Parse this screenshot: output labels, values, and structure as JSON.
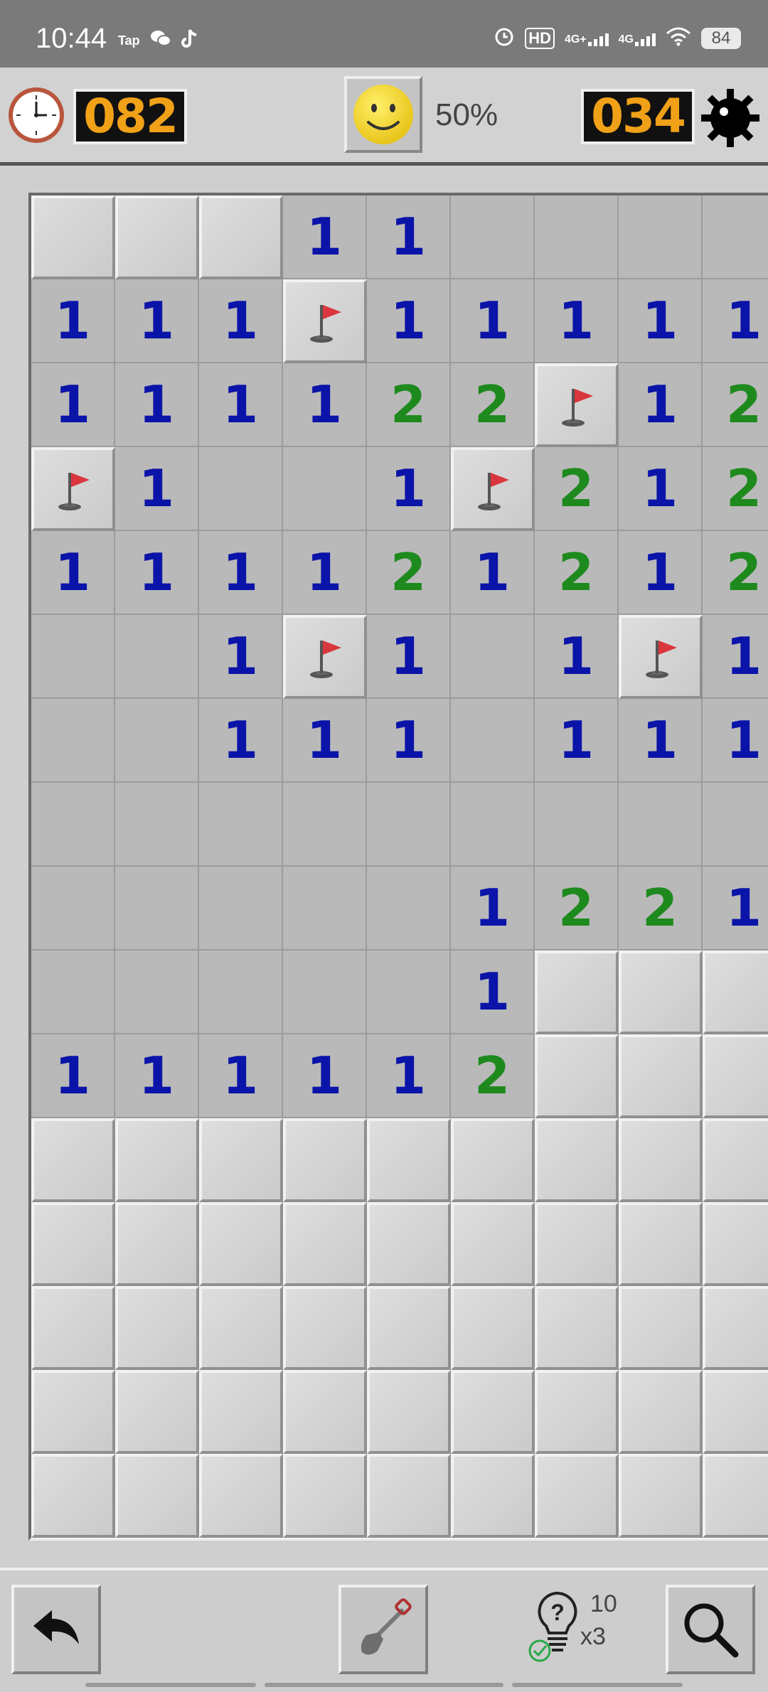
{
  "status_bar": {
    "time": "10:44",
    "apps": [
      "Tap",
      "wechat-icon",
      "tiktok-icon"
    ],
    "hd_label": "HD",
    "net1": "4G+",
    "net2": "4G",
    "battery": "84"
  },
  "header": {
    "timer": "082",
    "progress": "50%",
    "mines_left": "034"
  },
  "board": {
    "cols": 9,
    "rows": 16,
    "cells": [
      [
        "C",
        "C",
        "C",
        "1",
        "1",
        "0",
        "0",
        "0",
        "0"
      ],
      [
        "1",
        "1",
        "1",
        "F",
        "1",
        "1",
        "1",
        "1",
        "1"
      ],
      [
        "1",
        "1",
        "1",
        "1",
        "2",
        "2",
        "F",
        "1",
        "2"
      ],
      [
        "F",
        "1",
        "0",
        "0",
        "1",
        "F",
        "2",
        "1",
        "2"
      ],
      [
        "1",
        "1",
        "1",
        "1",
        "2",
        "1",
        "2",
        "1",
        "2"
      ],
      [
        "0",
        "0",
        "1",
        "F",
        "1",
        "0",
        "1",
        "F",
        "1"
      ],
      [
        "0",
        "0",
        "1",
        "1",
        "1",
        "0",
        "1",
        "1",
        "1"
      ],
      [
        "0",
        "0",
        "0",
        "0",
        "0",
        "0",
        "0",
        "0",
        "0"
      ],
      [
        "0",
        "0",
        "0",
        "0",
        "0",
        "1",
        "2",
        "2",
        "1"
      ],
      [
        "0",
        "0",
        "0",
        "0",
        "0",
        "1",
        "C",
        "C",
        "C"
      ],
      [
        "1",
        "1",
        "1",
        "1",
        "1",
        "2",
        "C",
        "C",
        "C"
      ],
      [
        "C",
        "C",
        "C",
        "C",
        "C",
        "C",
        "C",
        "C",
        "C"
      ],
      [
        "C",
        "C",
        "C",
        "C",
        "C",
        "C",
        "C",
        "C",
        "C"
      ],
      [
        "C",
        "C",
        "C",
        "C",
        "C",
        "C",
        "C",
        "C",
        "C"
      ],
      [
        "C",
        "C",
        "C",
        "C",
        "C",
        "C",
        "C",
        "C",
        "C"
      ],
      [
        "C",
        "C",
        "C",
        "C",
        "C",
        "C",
        "C",
        "C",
        "C"
      ]
    ]
  },
  "toolbar": {
    "hint_count": "10",
    "hint_multiplier": "x3",
    "hint_symbol": "?"
  },
  "colors": {
    "number_1": "#0a14a8",
    "number_2": "#1e8a1e",
    "lcd_digits": "#f0a118",
    "flag": "#d9363e"
  }
}
